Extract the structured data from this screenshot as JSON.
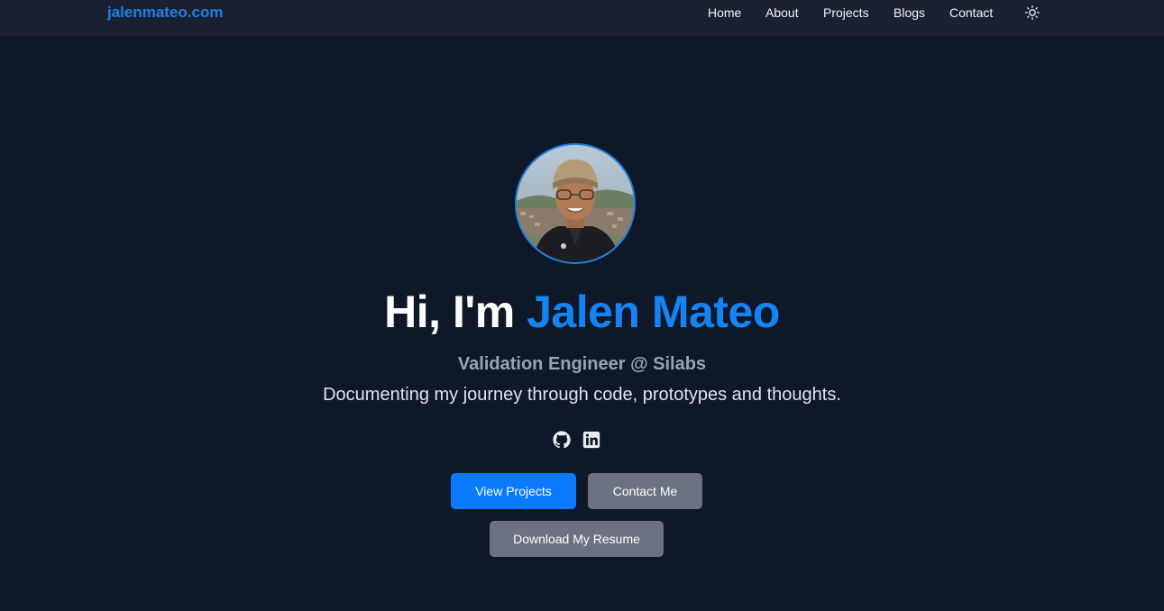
{
  "nav": {
    "brand": "jalenmateo.com",
    "links": [
      "Home",
      "About",
      "Projects",
      "Blogs",
      "Contact"
    ],
    "theme_toggle_icon": "sun-icon"
  },
  "hero": {
    "avatar_icon": "profile-photo",
    "title_prefix": "Hi, I'm ",
    "title_name": "Jalen Mateo",
    "role": "Validation Engineer @ Silabs",
    "tagline": "Documenting my journey through code, prototypes and thoughts.",
    "social_icons": [
      "github-icon",
      "linkedin-icon"
    ],
    "buttons": {
      "view_projects": "View Projects",
      "contact_me": "Contact Me",
      "download_resume": "Download My Resume"
    }
  },
  "colors": {
    "background": "#0f1828",
    "navbar": "#1a2231",
    "accent": "#1583f2",
    "primary_button": "#0a7bff",
    "secondary_button": "#6b7280",
    "muted_text": "#9aa3b2"
  }
}
